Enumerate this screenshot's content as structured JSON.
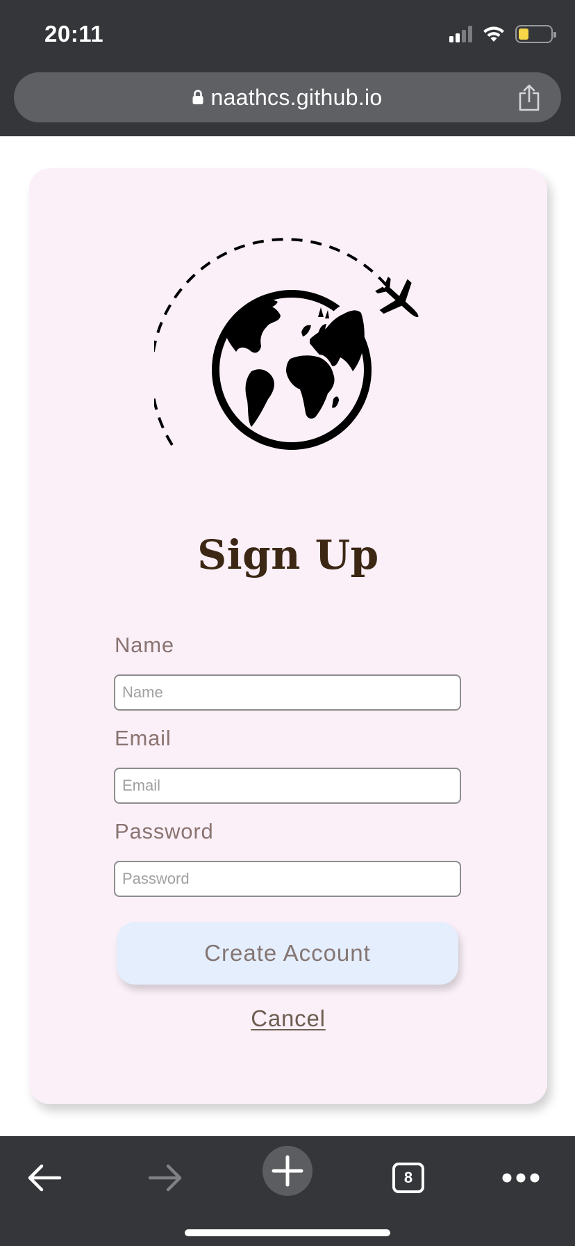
{
  "status_bar": {
    "time": "20:11",
    "icons": [
      "cellular-signal-icon",
      "wifi-icon",
      "battery-low-icon"
    ],
    "battery_color": "#f6d648"
  },
  "browser": {
    "url": "naathcs.github.io",
    "lock_icon": "lock-icon",
    "share_icon": "share-icon",
    "chrome_color": "#35363a"
  },
  "form": {
    "logo_icon": "globe-with-airplane-icon",
    "title": "Sign Up",
    "fields": [
      {
        "label": "Name",
        "placeholder": "Name",
        "value": ""
      },
      {
        "label": "Email",
        "placeholder": "Email",
        "value": ""
      },
      {
        "label": "Password",
        "placeholder": "Password",
        "value": ""
      }
    ],
    "submit_label": "Create Account",
    "cancel_label": "Cancel",
    "card_color": "#fbf0f8",
    "button_color": "#e4eefd",
    "title_color": "#3b2713"
  },
  "toolbar": {
    "back_icon": "back-arrow-icon",
    "forward_icon": "forward-arrow-icon",
    "new_tab_icon": "plus-icon",
    "tab_count": "8",
    "more_icon": "more-dots-icon"
  }
}
